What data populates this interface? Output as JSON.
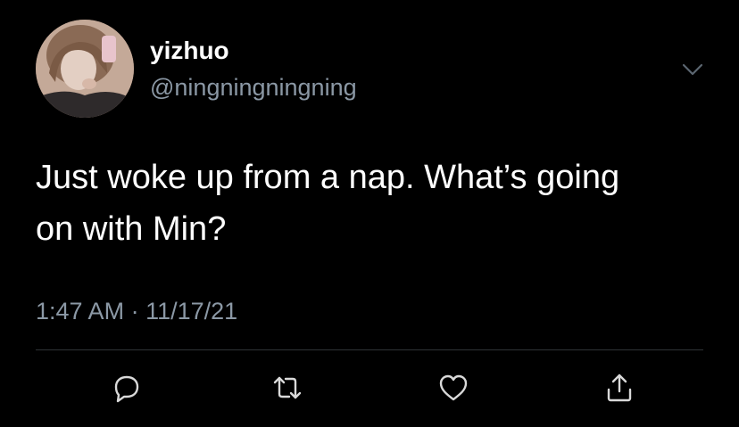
{
  "tweet": {
    "display_name": "yizhuo",
    "handle": "@ningningningning",
    "text": "Just woke up from a nap. What’s going\non with Min?",
    "time": "1:47 AM",
    "separator": "·",
    "date": "11/17/21"
  },
  "icons": {
    "menu": "chevron-down-icon",
    "reply": "reply-icon",
    "retweet": "retweet-icon",
    "like": "heart-icon",
    "share": "share-icon"
  },
  "colors": {
    "background": "#000000",
    "primary_text": "#ffffff",
    "secondary_text": "#8b98a5",
    "divider": "#2f3336"
  }
}
